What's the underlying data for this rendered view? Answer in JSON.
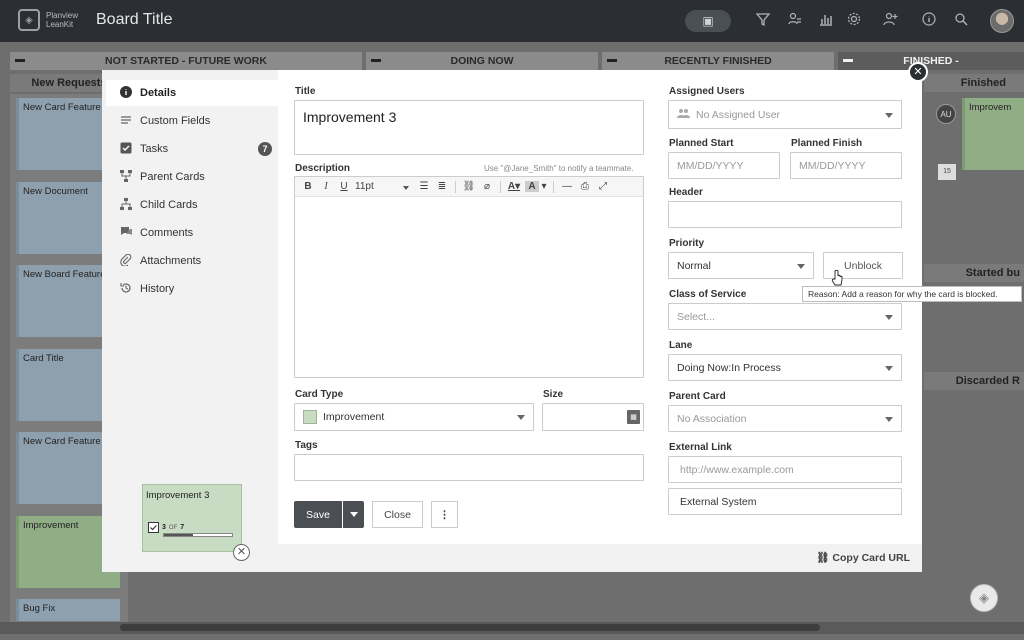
{
  "app": {
    "logo_line1": "Planview",
    "logo_line2": "LeanKit",
    "board_title": "Board Title"
  },
  "lanes": {
    "not_started": "NOT STARTED - FUTURE WORK",
    "doing_now": "DOING NOW",
    "recently_finished": "RECENTLY FINISHED",
    "finished": "FINISHED -",
    "new_requests": "New Requests",
    "finished_sub": "Finished",
    "started_but": "Started bu",
    "discarded": "Discarded R"
  },
  "board_cards": [
    "New Card Feature",
    "New Document",
    "New Board Feature",
    "Card Title",
    "New Card Feature",
    "Improvement",
    "Bug Fix"
  ],
  "right_board_card": "Improvem",
  "right_board_avatar": "AU",
  "right_board_date": "15",
  "nav": {
    "items": [
      {
        "label": "Details",
        "icon": "info-icon"
      },
      {
        "label": "Custom Fields",
        "icon": "custom-fields-icon"
      },
      {
        "label": "Tasks",
        "icon": "checkbox-icon",
        "badge": "7"
      },
      {
        "label": "Parent Cards",
        "icon": "parent-cards-icon"
      },
      {
        "label": "Child Cards",
        "icon": "child-cards-icon"
      },
      {
        "label": "Comments",
        "icon": "comments-icon"
      },
      {
        "label": "Attachments",
        "icon": "paperclip-icon"
      },
      {
        "label": "History",
        "icon": "history-icon"
      }
    ]
  },
  "form": {
    "title_label": "Title",
    "title_value": "Improvement 3",
    "description_label": "Description",
    "description_hint": "Use \"@Jane_Smith\" to notify a teammate.",
    "font_size": "11pt",
    "card_type_label": "Card Type",
    "card_type_value": "Improvement",
    "card_type_color": "#c8dcc4",
    "size_label": "Size",
    "tags_label": "Tags",
    "save_label": "Save",
    "close_label": "Close",
    "more_label": "⋮"
  },
  "details": {
    "assigned_users_label": "Assigned Users",
    "assigned_users_value": "No Assigned User",
    "planned_start_label": "Planned Start",
    "planned_start_placeholder": "MM/DD/YYYY",
    "planned_finish_label": "Planned Finish",
    "planned_finish_placeholder": "MM/DD/YYYY",
    "header_label": "Header",
    "priority_label": "Priority",
    "priority_value": "Normal",
    "unblock_label": "Unblock",
    "tooltip": "Reason: Add a reason for why the card is blocked.",
    "class_of_service_label": "Class of Service",
    "class_of_service_value": "Select...",
    "lane_label": "Lane",
    "lane_value": "Doing Now:In Process",
    "parent_card_label": "Parent Card",
    "parent_card_value": "No Association",
    "external_link_label": "External Link",
    "external_link_placeholder": "http://www.example.com",
    "external_system_value": "External System"
  },
  "preview": {
    "title": "Improvement 3",
    "task_count": "3",
    "task_of": "OF",
    "task_total": "7",
    "task_progress": 0.43
  },
  "footer": {
    "copy_url_label": "Copy Card URL"
  }
}
